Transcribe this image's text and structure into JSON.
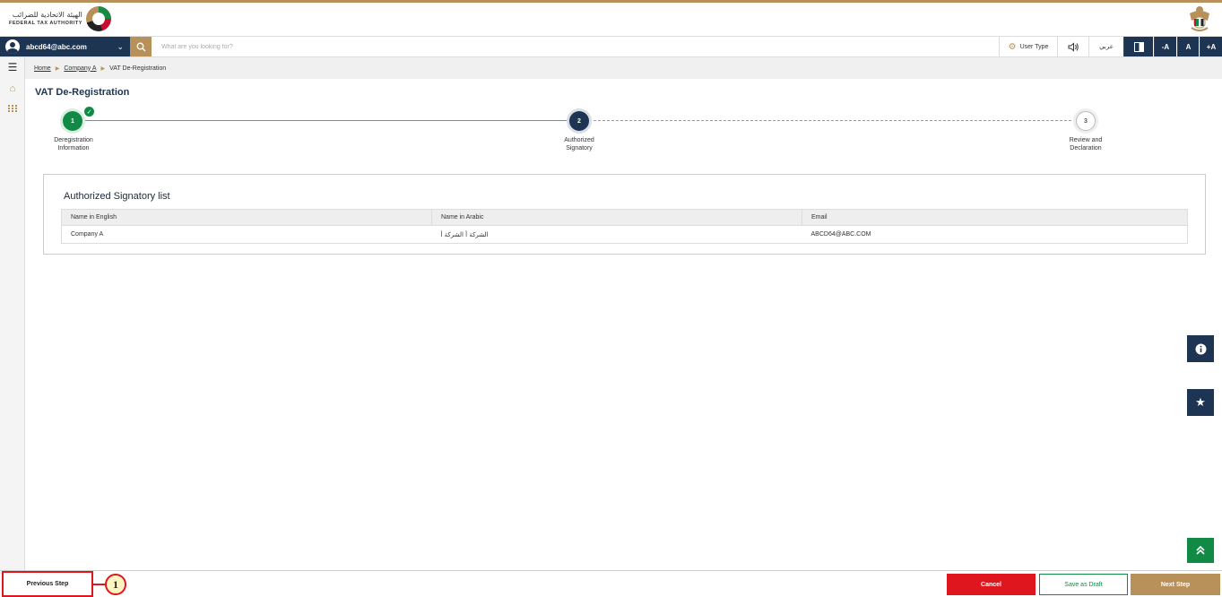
{
  "header": {
    "logo_arabic": "الهيئة الاتحادية للضرائب",
    "logo_english": "FEDERAL TAX AUTHORITY",
    "logo_icon": "fta-logo-icon",
    "emblem_icon": "uae-emblem-icon"
  },
  "toolbar": {
    "user_email": "abcd64@abc.com",
    "search_placeholder": "What are you looking for?",
    "user_type_label": "User Type",
    "arabic_label": "عربي",
    "font_decrease": "-A",
    "font_normal": "A",
    "font_increase": "+A"
  },
  "breadcrumb": {
    "home": "Home",
    "company": "Company A",
    "current": "VAT De-Registration"
  },
  "page": {
    "title": "VAT De-Registration"
  },
  "stepper": {
    "steps": [
      {
        "number": "1",
        "label_line1": "Deregistration",
        "label_line2": "Information",
        "status": "completed"
      },
      {
        "number": "2",
        "label_line1": "Authorized",
        "label_line2": "Signatory",
        "status": "active"
      },
      {
        "number": "3",
        "label_line1": "Review and",
        "label_line2": "Declaration",
        "status": "pending"
      }
    ]
  },
  "signatory": {
    "title": "Authorized Signatory list",
    "columns": [
      "Name in English",
      "Name in Arabic",
      "Email"
    ],
    "rows": [
      {
        "name_en": "Company A",
        "name_ar": "الشركة أ الشركة أ",
        "email": "ABCD64@ABC.COM"
      }
    ]
  },
  "footer": {
    "previous_label": "Previous Step",
    "callout_number": "1",
    "cancel_label": "Cancel",
    "draft_label": "Save as Draft",
    "next_label": "Next Step"
  },
  "colors": {
    "navy": "#1d3452",
    "gold": "#b8915a",
    "green": "#118a45",
    "red": "#e0161f"
  }
}
